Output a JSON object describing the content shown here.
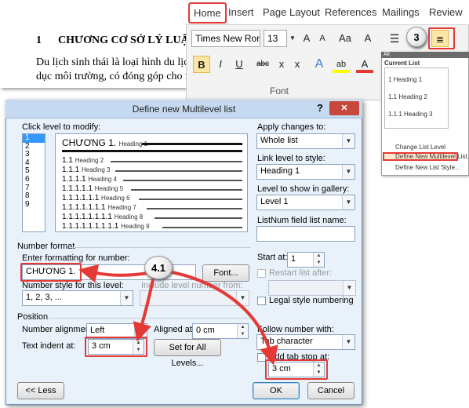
{
  "document": {
    "heading_number": "1",
    "heading_text": "CHƯƠNG CƠ SỞ LÝ LUẬN",
    "line1": "Du lịch sinh thái là loại hình du lịch",
    "line2": "dục môi trường, có đóng góp cho nỗ"
  },
  "ribbon": {
    "tabs": [
      "Home",
      "Insert",
      "Page Layout",
      "References",
      "Mailings",
      "Review"
    ],
    "font_name": "Times New Ron",
    "font_size": "13",
    "group_label": "Font",
    "buttons": {
      "grow": "A",
      "shrink": "A",
      "case": "Aa",
      "clear": "A",
      "bold": "B",
      "italic": "I",
      "underline": "U",
      "strike": "abc",
      "subscript": "x",
      "superscript": "x",
      "effects": "A",
      "highlight": "ab",
      "color": "A"
    }
  },
  "multilevel_panel": {
    "header": "All",
    "current_list": "Current List",
    "sample": [
      "1 Heading 1",
      "1.1 Heading 2",
      "1.1.1 Heading 3"
    ],
    "items": [
      "Change List Level",
      "Define New Multilevel List...",
      "Define New List Style..."
    ]
  },
  "dialog": {
    "title": "Define new Multilevel list",
    "help": "?",
    "close": "✕",
    "click_level_label": "Click level to modify:",
    "levels": [
      "1",
      "2",
      "3",
      "4",
      "5",
      "6",
      "7",
      "8",
      "9"
    ],
    "selected_level": "1",
    "preview_rows": [
      {
        "num": "CHƯƠNG 1.",
        "heading": "Heading 1"
      },
      {
        "num": "1.1",
        "heading": "Heading 2"
      },
      {
        "num": "1.1.1",
        "heading": "Heading 3"
      },
      {
        "num": "1.1.1.1",
        "heading": "Heading 4"
      },
      {
        "num": "1.1.1.1.1",
        "heading": "Heading 5"
      },
      {
        "num": "1.1.1.1.1.1",
        "heading": "Heading 6"
      },
      {
        "num": "1.1.1.1.1.1.1",
        "heading": "Heading 7"
      },
      {
        "num": "1.1.1.1.1.1.1.1",
        "heading": "Heading 8"
      },
      {
        "num": "1.1.1.1.1.1.1.1.1",
        "heading": "Heading 9"
      }
    ],
    "apply_label": "Apply changes to:",
    "apply_value": "Whole list",
    "link_label": "Link level to style:",
    "link_value": "Heading 1",
    "show_level_label": "Level to show in gallery:",
    "show_level_value": "Level 1",
    "listnum_label": "ListNum field list name:",
    "listnum_value": "",
    "number_format_section": "Number format",
    "enter_format_label": "Enter formatting for number:",
    "format_value": "CHƯƠNG 1.",
    "font_button": "Font...",
    "number_style_label": "Number style for this level:",
    "number_style_value": "1, 2, 3, ...",
    "include_level_label": "Include level number from:",
    "include_level_value": "",
    "start_at_label": "Start at:",
    "start_at_value": "1",
    "restart_label": "Restart list after:",
    "restart_value": "",
    "legal_label": "Legal style numbering",
    "position_section": "Position",
    "alignment_label": "Number alignment:",
    "alignment_value": "Left",
    "aligned_at_label": "Aligned at:",
    "aligned_at_value": "0 cm",
    "indent_label": "Text indent at:",
    "indent_value": "3 cm",
    "set_all_button": "Set for All Levels...",
    "follow_label": "Follow number with:",
    "follow_value": "Tab character",
    "add_tab_label": "Add tab stop at:",
    "add_tab_value": "3 cm",
    "less_button": "<< Less",
    "ok_button": "OK",
    "cancel_button": "Cancel"
  },
  "annotations": {
    "step3": "3",
    "step41": "4.1",
    "accent": "#e53935"
  }
}
